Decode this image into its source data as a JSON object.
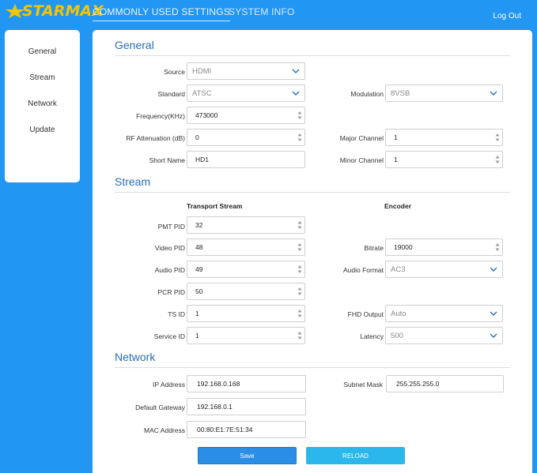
{
  "brand": {
    "name": "STARMAX",
    "color": "#f4c400"
  },
  "nav": {
    "tabs": [
      "COMMONLY USED SETTINGS",
      "SYSTEM INFO"
    ],
    "logout": "Log Out"
  },
  "sidebar": {
    "items": [
      "General",
      "Stream",
      "Network",
      "Update"
    ]
  },
  "general": {
    "title": "General",
    "source": {
      "label": "Source",
      "value": "HDMI"
    },
    "standard": {
      "label": "Standard",
      "value": "ATSC"
    },
    "frequency": {
      "label": "Frequency(KHz)",
      "value": "473000"
    },
    "rf_attenuation": {
      "label": "RF Attenuation (dB)",
      "value": "0"
    },
    "short_name": {
      "label": "Short Name",
      "value": "HD1"
    },
    "modulation": {
      "label": "Modulation",
      "value": "8VSB"
    },
    "major_channel": {
      "label": "Major Channel",
      "value": "1"
    },
    "minor_channel": {
      "label": "Minor Channel",
      "value": "1"
    }
  },
  "stream": {
    "title": "Stream",
    "transport_header": "Transport Stream",
    "encoder_header": "Encoder",
    "pmt_pid": {
      "label": "PMT PID",
      "value": "32"
    },
    "video_pid": {
      "label": "Video PID",
      "value": "48"
    },
    "audio_pid": {
      "label": "Audio PID",
      "value": "49"
    },
    "pcr_pid": {
      "label": "PCR PID",
      "value": "50"
    },
    "ts_id": {
      "label": "TS ID",
      "value": "1"
    },
    "service_id": {
      "label": "Service ID",
      "value": "1"
    },
    "bitrate": {
      "label": "Bitrate",
      "value": "19000"
    },
    "audio_format": {
      "label": "Audio Format",
      "value": "AC3"
    },
    "fhd_output": {
      "label": "FHD Output",
      "value": "Auto"
    },
    "latency": {
      "label": "Latency",
      "value": "500"
    }
  },
  "network": {
    "title": "Network",
    "ip_address": {
      "label": "IP Address",
      "value": "192.168.0.168"
    },
    "subnet_mask": {
      "label": "Subnet Mask",
      "value": "255.255.255.0"
    },
    "default_gateway": {
      "label": "Default Gateway",
      "value": "192.168.0.1"
    },
    "mac_address": {
      "label": "MAC Address",
      "value": "00:80:E1:7E:51:34"
    }
  },
  "buttons": {
    "save": "Save",
    "reload": "RELOAD"
  }
}
